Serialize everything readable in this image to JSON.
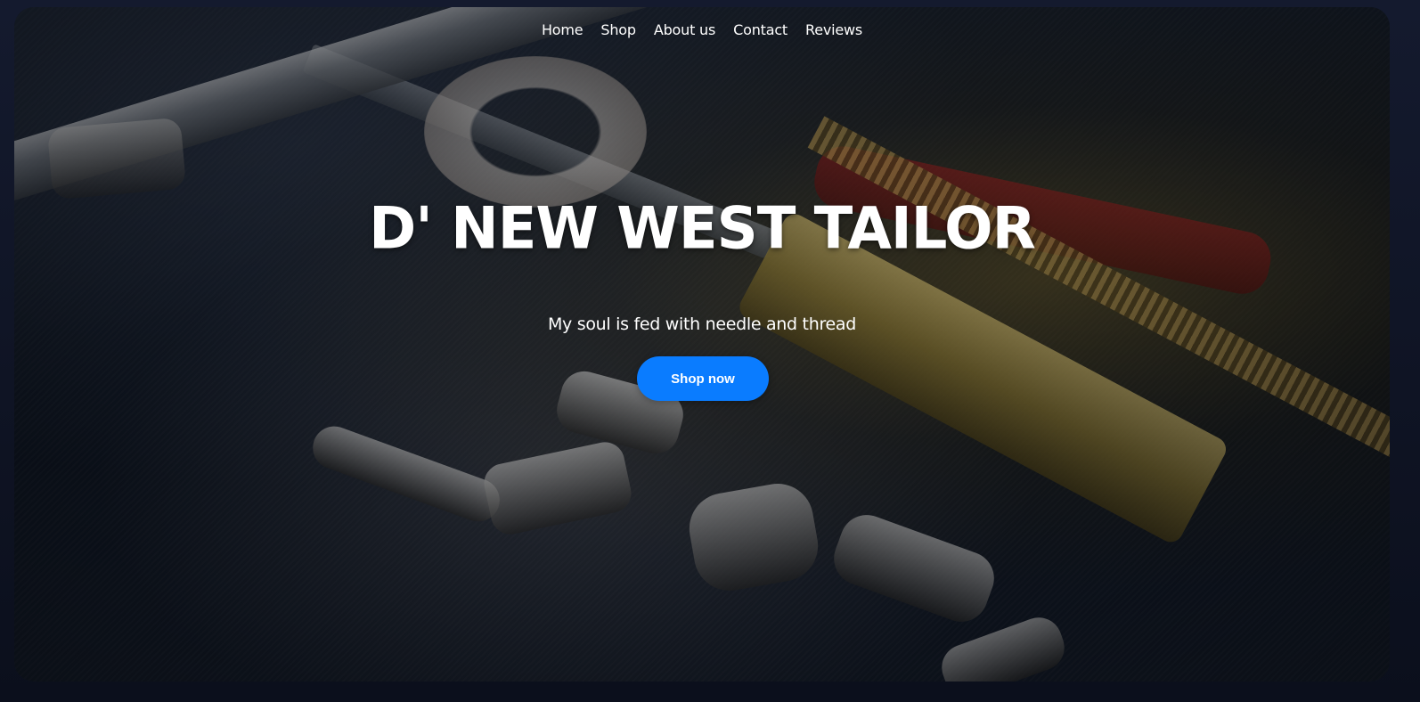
{
  "nav": {
    "items": [
      {
        "label": "Home"
      },
      {
        "label": "Shop"
      },
      {
        "label": "About us"
      },
      {
        "label": "Contact"
      },
      {
        "label": "Reviews"
      }
    ]
  },
  "hero": {
    "title": "D' NEW WEST TAILOR",
    "tagline": "My soul is fed with needle and thread",
    "cta_label": "Shop now",
    "background": "tailoring-tools-photo"
  },
  "colors": {
    "accent": "#0a7cff",
    "text": "#ffffff",
    "page_background": "#0e1322"
  }
}
